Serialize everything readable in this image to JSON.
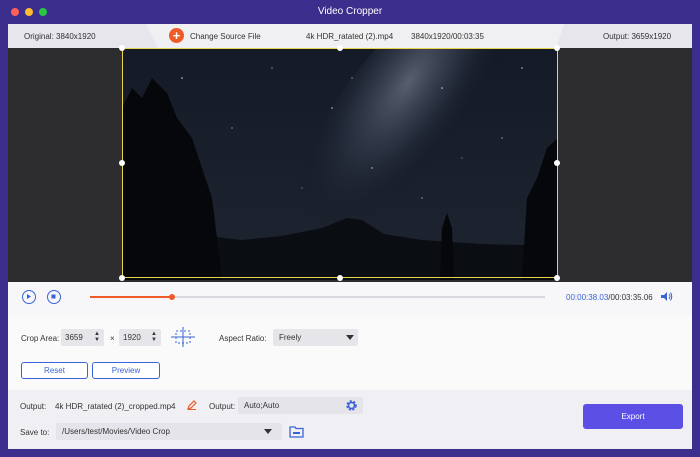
{
  "window": {
    "title": "Video Cropper"
  },
  "infobar": {
    "original": "Original: 3840x1920",
    "change_source": "Change Source File",
    "filename": "4k HDR_ratated (2).mp4",
    "meta": "3840x1920/00:03:35",
    "output": "Output: 3659x1920"
  },
  "player": {
    "current_time": "00:00:38.03",
    "total_time": "/00:03:35.06",
    "progress": 0.18
  },
  "crop": {
    "label": "Crop Area:",
    "width": "3659",
    "times": "×",
    "height": "1920",
    "aspect_label": "Aspect Ratio:",
    "aspect_value": "Freely",
    "reset": "Reset",
    "preview": "Preview"
  },
  "output": {
    "label": "Output:",
    "filename": "4k HDR_ratated (2)_cropped.mp4",
    "settings_label": "Output:",
    "settings_value": "Auto;Auto",
    "save_label": "Save to:",
    "save_path": "/Users/test/Movies/Video Crop",
    "export": "Export"
  },
  "colors": {
    "titlebar": "#3c2e8c",
    "accent": "#3a63d8",
    "orange": "#f05a28",
    "export": "#5b4fe6",
    "crop_frame": "#e8d44a"
  },
  "icons": [
    "close-icon",
    "minimize-icon",
    "maximize-icon",
    "plus-icon",
    "play-icon",
    "stop-icon",
    "volume-icon",
    "center-crosshair-icon",
    "edit-pencil-icon",
    "gear-icon",
    "folder-icon",
    "chevron-down-icon"
  ]
}
